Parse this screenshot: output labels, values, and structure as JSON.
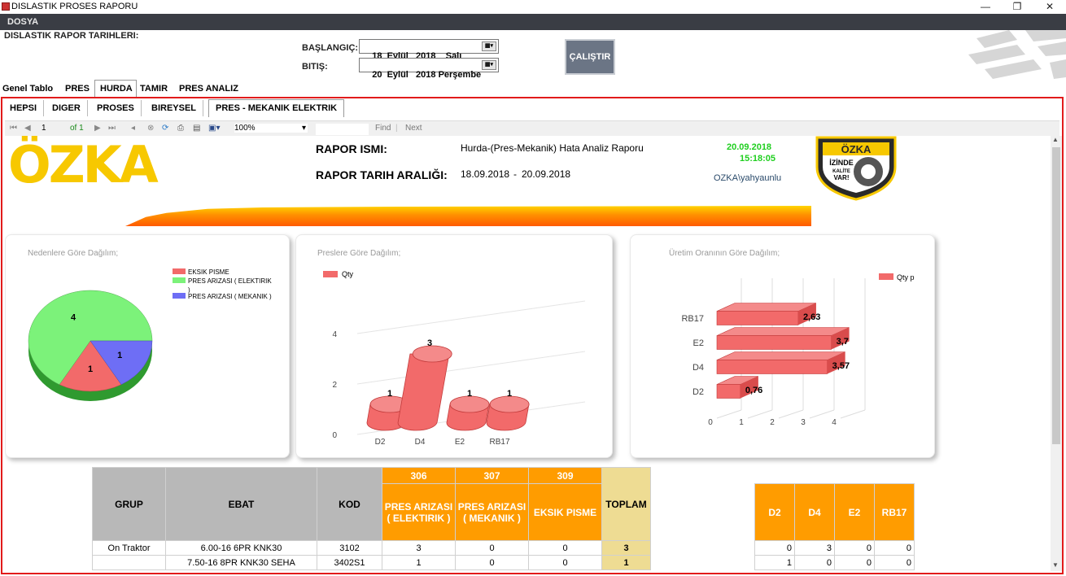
{
  "window": {
    "title": "DISLASTIK PROSES RAPORU",
    "minimize": "—",
    "restore": "❐",
    "close": "✕"
  },
  "menu": {
    "file": "DOSYA"
  },
  "header": {
    "section_label": "DISLASTIK RAPOR TARIHLERI:",
    "start_label": "BAŞLANGIÇ:",
    "start_value": "18  Eylül   2018    Salı",
    "end_label": "BITIŞ:",
    "end_value": "20  Eylül   2018 Perşembe",
    "run_button": "ÇALIŞTIR"
  },
  "main_tabs": [
    "Genel Tablo",
    "PRES",
    "HURDA",
    "TAMIR",
    "PRES ANALIZ"
  ],
  "sub_tabs": [
    "HEPSI",
    "DIGER",
    "PROSES",
    "BIREYSEL",
    "PRES - MEKANIK ELEKTRIK"
  ],
  "toolbar": {
    "page": "1",
    "of": "of 1",
    "zoom": "100%",
    "find": "Find",
    "next": "Next"
  },
  "report": {
    "logo_text": "ÖZKA",
    "name_label": "RAPOR ISMI:",
    "name_value": "Hurda-(Pres-Mekanik) Hata Analiz Raporu",
    "range_label": "RAPOR TARIH ARALIĞI:",
    "range_from": "18.09.2018",
    "range_sep": "-",
    "range_to": "20.09.2018",
    "print_date": "20.09.2018",
    "print_time": "15:18:05",
    "user": "OZKA\\yahyaunlu",
    "badge": {
      "top": "ÖZKA",
      "l1": "İZİNDE",
      "l2": "KALİTE",
      "l3": "VAR!"
    }
  },
  "chart_data": [
    {
      "type": "pie",
      "title": "Nedenlere Göre Dağılım;",
      "categories": [
        "EKSIK PISME",
        "PRES ARIZASI ( ELEKTIRIK )",
        "PRES ARIZASI ( MEKANIK )"
      ],
      "values": [
        1,
        4,
        1
      ],
      "legend": [
        "EKSIK PISME",
        "PRES ARIZASI ( ELEKTIRIK",
        ")",
        "PRES ARIZASI ( MEKANIK )"
      ],
      "colors": [
        "#f26a6a",
        "#7cf27a",
        "#6e6ef5"
      ],
      "legend_position": "top-right"
    },
    {
      "type": "bar",
      "title": "Preslere Göre Dağılım;",
      "categories": [
        "D2",
        "D4",
        "E2",
        "RB17"
      ],
      "series": [
        {
          "name": "Qty",
          "values": [
            1,
            3,
            1,
            1
          ]
        }
      ],
      "yticks": [
        "0",
        "2",
        "4"
      ],
      "ylim": [
        0,
        4
      ],
      "color": "#f26a6a",
      "legend_position": "top-left"
    },
    {
      "type": "bar",
      "title": "Üretim Oranının Göre Dağılım;",
      "orientation": "horizontal",
      "categories": [
        "D2",
        "D4",
        "E2",
        "RB17"
      ],
      "series": [
        {
          "name": "Qty p",
          "values": [
            0.76,
            3.57,
            3.7,
            2.63
          ]
        }
      ],
      "value_labels": [
        "0,76",
        "3,57",
        "3,7",
        "2,63"
      ],
      "xticks": [
        "0",
        "1",
        "2",
        "3",
        "4"
      ],
      "xlim": [
        0,
        4
      ],
      "color": "#f26a6a",
      "legend_position": "top-right"
    }
  ],
  "table": {
    "headers": {
      "grup": "GRUP",
      "ebat": "EBAT",
      "kod": "KOD",
      "c1": "306",
      "c2": "307",
      "c3": "309",
      "n1": "PRES ARIZASI ( ELEKTIRIK )",
      "n2": "PRES ARIZASI ( MEKANIK )",
      "n3": "EKSIK PISME",
      "total": "TOPLAM"
    },
    "rows": [
      {
        "grup": "On Traktor",
        "ebat": "6.00-16 6PR KNK30",
        "kod": "3102",
        "v1": "3",
        "v2": "0",
        "v3": "0",
        "total": "3"
      },
      {
        "grup": "",
        "ebat": "7.50-16 8PR KNK30 SEHA",
        "kod": "3402S1",
        "v1": "1",
        "v2": "0",
        "v3": "0",
        "total": "1"
      }
    ]
  },
  "side_table": {
    "headers": [
      "D2",
      "D4",
      "E2",
      "RB17"
    ],
    "rows": [
      [
        "0",
        "3",
        "0",
        "0"
      ],
      [
        "1",
        "0",
        "0",
        "0"
      ]
    ]
  }
}
